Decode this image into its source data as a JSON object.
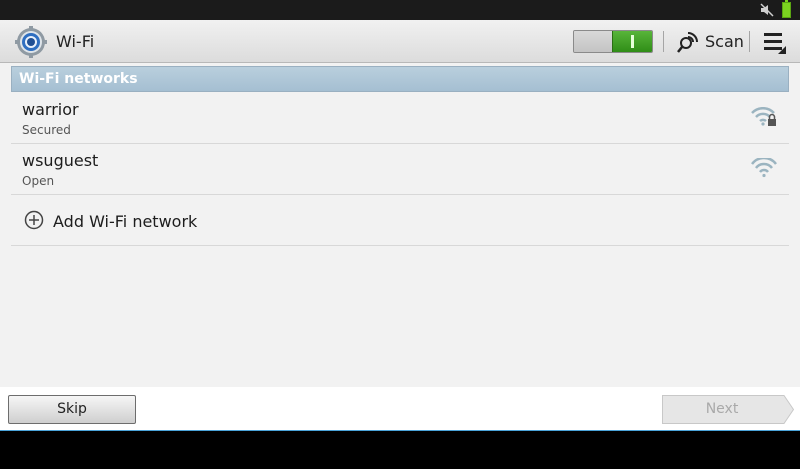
{
  "status_bar": {
    "mute_icon": "muted-speaker-icon",
    "battery_icon": "battery-icon",
    "battery_color": "#7bd320"
  },
  "action_bar": {
    "app_icon": "wifi-settings-gear-icon",
    "title": "Wi-Fi",
    "toggle": {
      "state": "on",
      "on_color": "#3a9a20"
    },
    "scan_label": "Scan",
    "scan_icon": "scan-radar-icon",
    "menu_icon": "overflow-menu-icon"
  },
  "section": {
    "header": "Wi-Fi networks",
    "header_color": "#a9c2d4"
  },
  "networks": [
    {
      "name": "warrior",
      "status": "Secured",
      "icon": "wifi-secured-icon"
    },
    {
      "name": "wsuguest",
      "status": "Open",
      "icon": "wifi-open-icon"
    }
  ],
  "add_network": {
    "label": "Add Wi-Fi network",
    "icon": "plus-circle-icon"
  },
  "footer": {
    "skip_label": "Skip",
    "next_label": "Next",
    "next_enabled": false
  }
}
